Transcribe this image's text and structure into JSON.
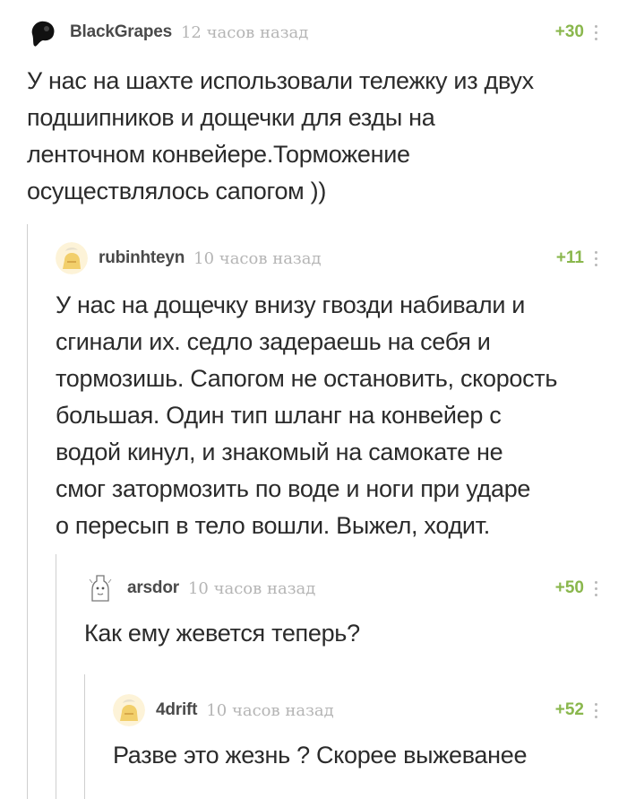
{
  "comments": [
    {
      "username": "BlackGrapes",
      "time": "12 часов назад",
      "rating": "+30",
      "lines": [
        "У нас на шахте использовали тележку из двух",
        "подшипников и дощечки для езды на",
        "ленточном конвейере.Торможение",
        "осуществлялось сапогом ))"
      ],
      "avatar_icon": "dark-blob-avatar-icon"
    },
    {
      "username": "rubinhteyn",
      "time": "10 часов назад",
      "rating": "+11",
      "lines": [
        "У нас на дощечку внизу гвозди набивали и",
        "сгинали их. седло задераешь на себя и",
        "тормозишь. Сапогом не остановить, скорость",
        "большая. Один тип шланг на конвейер с",
        "водой кинул, и знакомый на самокате не",
        "смог затормозить по воде и ноги при ударе",
        "о пересып в тело вошли. Выжел, ходит."
      ],
      "avatar_icon": "default-yellow-avatar-icon"
    },
    {
      "username": "arsdor",
      "time": "10 часов назад",
      "rating": "+50",
      "lines": [
        "Как ему жевется теперь?"
      ],
      "avatar_icon": "sketch-bottle-avatar-icon"
    },
    {
      "username": "4drift",
      "time": "10 часов назад",
      "rating": "+52",
      "lines": [
        "Разве это жезнь ? Скорее выжеванее"
      ],
      "avatar_icon": "default-yellow-avatar-icon"
    }
  ],
  "colors": {
    "rating": "#8ab74d",
    "time": "#b5b5b5",
    "username": "#4a4a4a",
    "thread_line": "#cfcfcf"
  }
}
